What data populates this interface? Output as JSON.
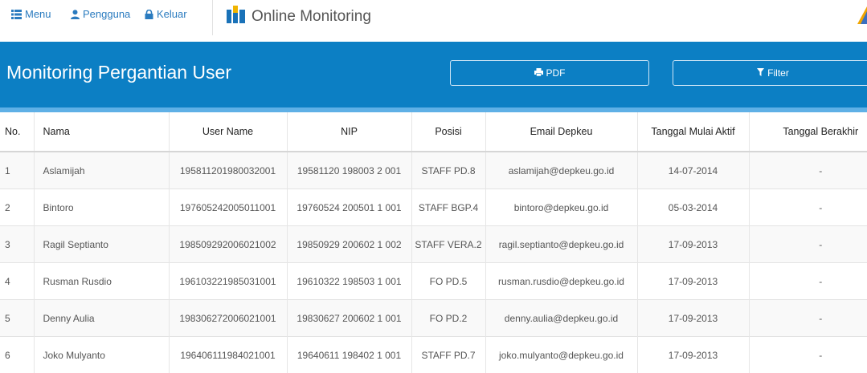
{
  "nav": {
    "menu_label": "Menu",
    "users_label": "Pengguna",
    "logout_label": "Keluar",
    "brand_label": "Online Monitoring"
  },
  "header": {
    "title": "Monitoring Pergantian User",
    "pdf_label": "PDF",
    "filter_label": "Filter"
  },
  "table": {
    "columns": [
      "No.",
      "Nama",
      "User Name",
      "NIP",
      "Posisi",
      "Email Depkeu",
      "Tanggal Mulai Aktif",
      "Tanggal Berakhir"
    ],
    "rows": [
      [
        "1",
        "Aslamijah",
        "195811201980032001",
        "19581120 198003 2 001",
        "STAFF PD.8",
        "aslamijah@depkeu.go.id",
        "14-07-2014",
        "-"
      ],
      [
        "2",
        "Bintoro",
        "197605242005011001",
        "19760524 200501 1 001",
        "STAFF BGP.4",
        "bintoro@depkeu.go.id",
        "05-03-2014",
        "-"
      ],
      [
        "3",
        "Ragil Septianto",
        "198509292006021002",
        "19850929 200602 1 002",
        "STAFF VERA.2",
        "ragil.septianto@depkeu.go.id",
        "17-09-2013",
        "-"
      ],
      [
        "4",
        "Rusman Rusdio",
        "196103221985031001",
        "19610322 198503 1 001",
        "FO PD.5",
        "rusman.rusdio@depkeu.go.id",
        "17-09-2013",
        "-"
      ],
      [
        "5",
        "Denny Aulia",
        "198306272006021001",
        "19830627 200602 1 001",
        "FO PD.2",
        "denny.aulia@depkeu.go.id",
        "17-09-2013",
        "-"
      ],
      [
        "6",
        "Joko Mulyanto",
        "196406111984021001",
        "19640611 198402 1 001",
        "STAFF PD.7",
        "joko.mulyanto@depkeu.go.id",
        "17-09-2013",
        "-"
      ]
    ]
  },
  "colors": {
    "band": "#0c7fc4",
    "band_accent": "#5fb0e6",
    "nav_link": "#2a7bbf",
    "brand_icon": "#1a72b8"
  }
}
